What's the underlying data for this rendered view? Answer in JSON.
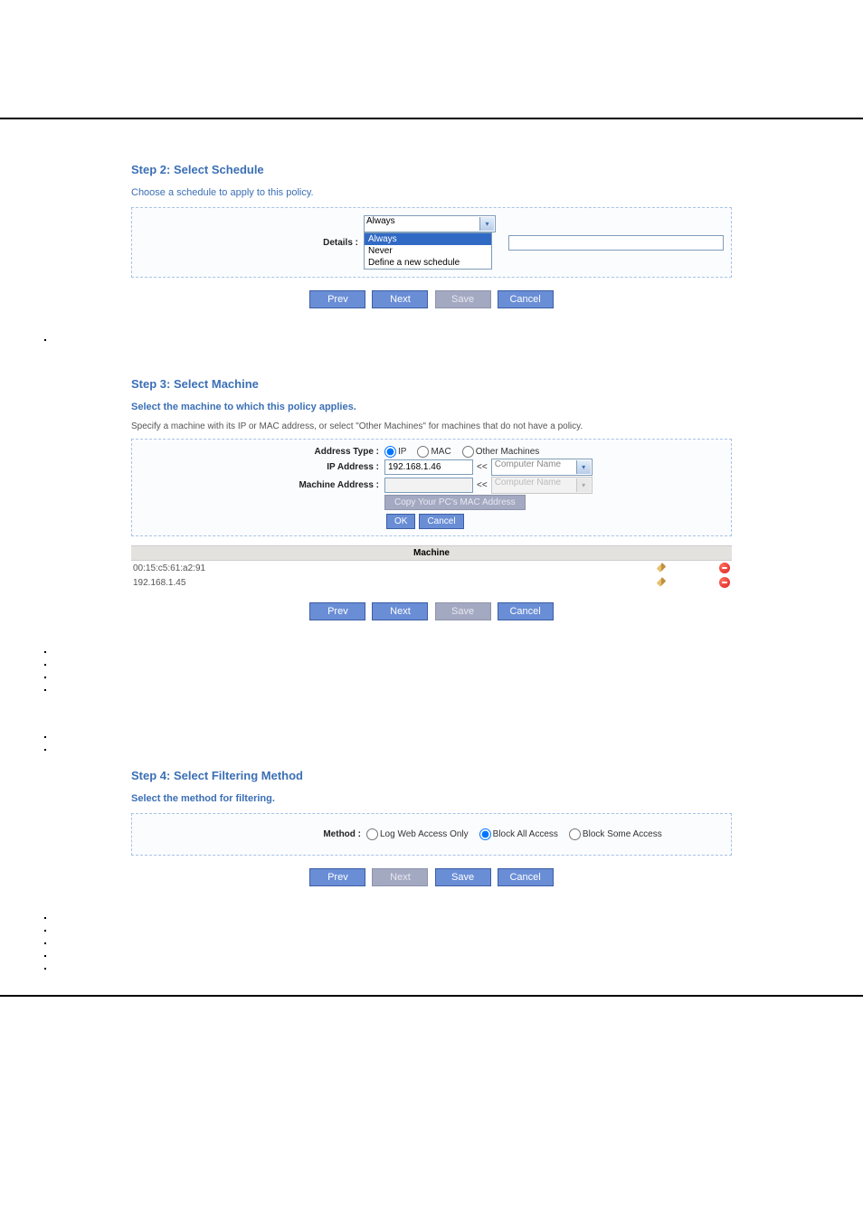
{
  "step2": {
    "title": "Step 2: Select Schedule",
    "subtitle": "Choose a schedule to apply to this policy.",
    "details_label": "Details :",
    "select_value": "Always",
    "options": {
      "o0": "Always",
      "o1": "Never",
      "o2": "Define a new schedule"
    },
    "buttons": {
      "prev": "Prev",
      "next": "Next",
      "save": "Save",
      "cancel": "Cancel"
    }
  },
  "step3": {
    "title": "Step 3: Select Machine",
    "subtitle": "Select the machine to which this policy applies.",
    "desc": "Specify a machine with its IP or MAC address, or select \"Other Machines\" for machines that do not have a policy.",
    "labels": {
      "address_type": "Address Type :",
      "ip_address": "IP Address :",
      "machine_address": "Machine Address :"
    },
    "address_type_options": {
      "ip": "IP",
      "mac": "MAC",
      "other": "Other Machines"
    },
    "ip_value": "192.168.1.46",
    "computer_name_label": "Computer Name",
    "copy_mac_label": "Copy Your PC's MAC Address",
    "ok": "OK",
    "cancel": "Cancel",
    "table_header": "Machine",
    "machines": {
      "m0": "00:15:c5:61:a2:91",
      "m1": "192.168.1.45"
    },
    "buttons": {
      "prev": "Prev",
      "next": "Next",
      "save": "Save",
      "cancel": "Cancel"
    }
  },
  "step4": {
    "title": "Step 4: Select Filtering Method",
    "subtitle": "Select the method for filtering.",
    "method_label": "Method :",
    "options": {
      "log": "Log Web Access Only",
      "blockall": "Block All Access",
      "blocksome": "Block Some Access"
    },
    "buttons": {
      "prev": "Prev",
      "next": "Next",
      "save": "Save",
      "cancel": "Cancel"
    }
  }
}
